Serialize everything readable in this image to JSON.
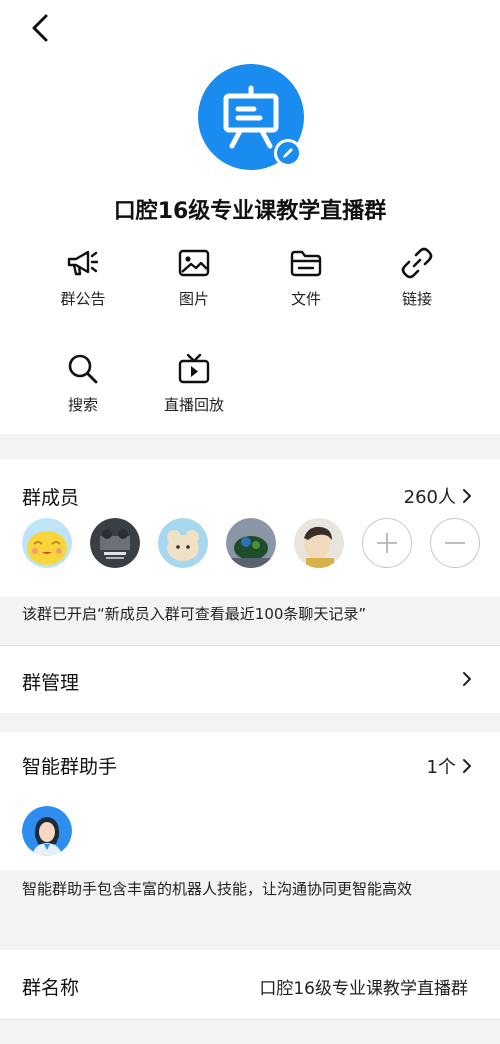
{
  "header": {
    "back_icon": "back-arrow-icon"
  },
  "group": {
    "avatar_icon": "presentation-board-icon",
    "edit_icon": "pencil-icon",
    "title": "口腔16级专业课教学直播群"
  },
  "actions": [
    {
      "label": "群公告",
      "icon": "megaphone-icon"
    },
    {
      "label": "图片",
      "icon": "image-icon"
    },
    {
      "label": "文件",
      "icon": "folder-icon"
    },
    {
      "label": "链接",
      "icon": "link-icon"
    },
    {
      "label": "搜索",
      "icon": "search-icon"
    },
    {
      "label": "直播回放",
      "icon": "tv-playback-icon"
    }
  ],
  "members": {
    "title": "群成员",
    "count": "260人",
    "notice": "该群已开启“新成员入群可查看最近100条聊天记录”"
  },
  "manage": {
    "title": "群管理"
  },
  "assistant": {
    "title": "智能群助手",
    "count": "1个",
    "description": "智能群助手包含丰富的机器人技能，让沟通协同更智能高效"
  },
  "group_name": {
    "label": "群名称",
    "value": "口腔16级专业课教学直播群"
  },
  "colors": {
    "accent": "#1a8cf0",
    "background": "#f2f3f5"
  }
}
